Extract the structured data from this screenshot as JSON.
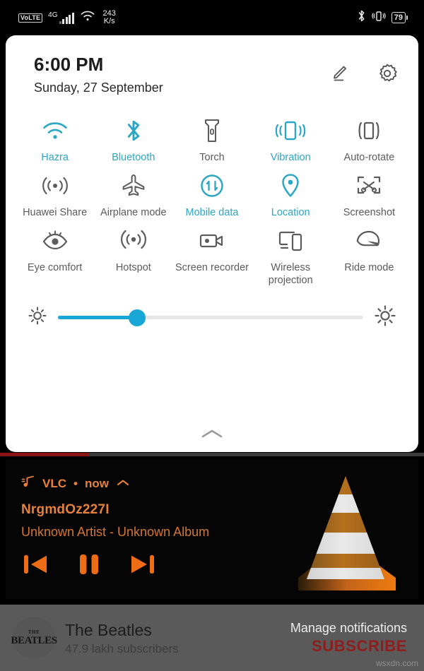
{
  "statusbar": {
    "volte": "VoLTE",
    "network_type": "4G",
    "net_speed_value": "243",
    "net_speed_unit": "K/s",
    "bluetooth_icon": "bluetooth-icon",
    "vibrate_icon": "vibrate-icon",
    "battery_level": "79"
  },
  "panel": {
    "time": "6:00 PM",
    "date": "Sunday, 27 September",
    "edit_icon": "pencil-icon",
    "settings_icon": "gear-icon",
    "collapse_icon": "chevron-up-icon",
    "accent_color": "#2ba7c4",
    "inactive_color": "#5c5c5c",
    "slider_color": "#17a6d6",
    "brightness_percent": 26,
    "brightness_low_icon": "brightness-low-icon",
    "brightness_high_icon": "brightness-high-icon",
    "tiles": [
      [
        {
          "label": "Hazra",
          "icon": "wifi-icon",
          "active": true
        },
        {
          "label": "Bluetooth",
          "icon": "bluetooth-icon",
          "active": true
        },
        {
          "label": "Torch",
          "icon": "flashlight-icon",
          "active": false
        },
        {
          "label": "Vibration",
          "icon": "vibrate-icon",
          "active": true
        },
        {
          "label": "Auto-rotate",
          "icon": "auto-rotate-icon",
          "active": false
        }
      ],
      [
        {
          "label": "Huawei Share",
          "icon": "huawei-share-icon",
          "active": false
        },
        {
          "label": "Airplane mode",
          "icon": "airplane-icon",
          "active": false
        },
        {
          "label": "Mobile data",
          "icon": "mobile-data-icon",
          "active": true
        },
        {
          "label": "Location",
          "icon": "location-pin-icon",
          "active": true
        },
        {
          "label": "Screenshot",
          "icon": "screenshot-icon",
          "active": false
        }
      ],
      [
        {
          "label": "Eye comfort",
          "icon": "eye-comfort-icon",
          "active": false
        },
        {
          "label": "Hotspot",
          "icon": "hotspot-icon",
          "active": false
        },
        {
          "label": "Screen recorder",
          "icon": "screen-recorder-icon",
          "active": false
        },
        {
          "label": "Wireless projection",
          "icon": "wireless-projection-icon",
          "active": false
        },
        {
          "label": "Ride mode",
          "icon": "ride-mode-icon",
          "active": false
        }
      ]
    ]
  },
  "media": {
    "app_name": "VLC",
    "separator": "•",
    "time_ago": "now",
    "expand_icon": "chevron-up-icon",
    "music_icon": "music-note-icon",
    "track_title": "NrgmdOz227I",
    "track_subtitle": "Unknown Artist - Unknown Album",
    "accent_color": "#e8813a",
    "controls": [
      {
        "name": "previous-button",
        "icon": "skip-previous-icon"
      },
      {
        "name": "pause-button",
        "icon": "pause-icon"
      },
      {
        "name": "next-button",
        "icon": "skip-next-icon"
      }
    ],
    "artwork": "vlc-cone-icon"
  },
  "video_progress": {
    "played_percent": 21,
    "played_color": "#8c1410"
  },
  "youtube": {
    "avatar_the": "THE",
    "avatar_name": "BEATLES",
    "channel": "The Beatles",
    "subscribers": "47.9 lakh subscribers",
    "manage": "Manage notifications",
    "subscribe": "SUBSCRIBE",
    "subscribe_color": "#8f1d1d"
  },
  "watermark": "wsxdn.com"
}
